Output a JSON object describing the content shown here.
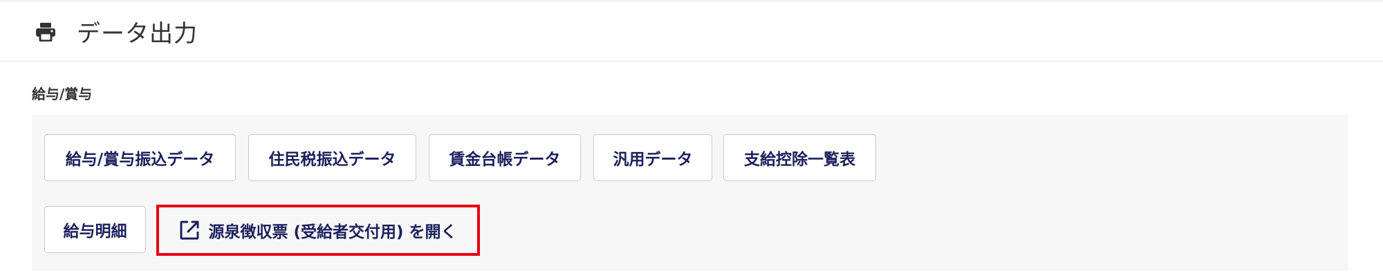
{
  "header": {
    "title": "データ出力",
    "icon": "printer-icon"
  },
  "section": {
    "label": "給与/賞与"
  },
  "buttons": {
    "salary_bonus_transfer": "給与/賞与振込データ",
    "resident_tax_transfer": "住民税振込データ",
    "wage_ledger": "賃金台帳データ",
    "general_data": "汎用データ",
    "payment_deduction_list": "支給控除一覧表",
    "pay_slip": "給与明細",
    "withholding_slip": "源泉徴収票 (受給者交付用) を開く"
  },
  "colors": {
    "button_text": "#1b1f5c",
    "highlight": "#e60012",
    "panel_bg": "#f7f7f7"
  }
}
